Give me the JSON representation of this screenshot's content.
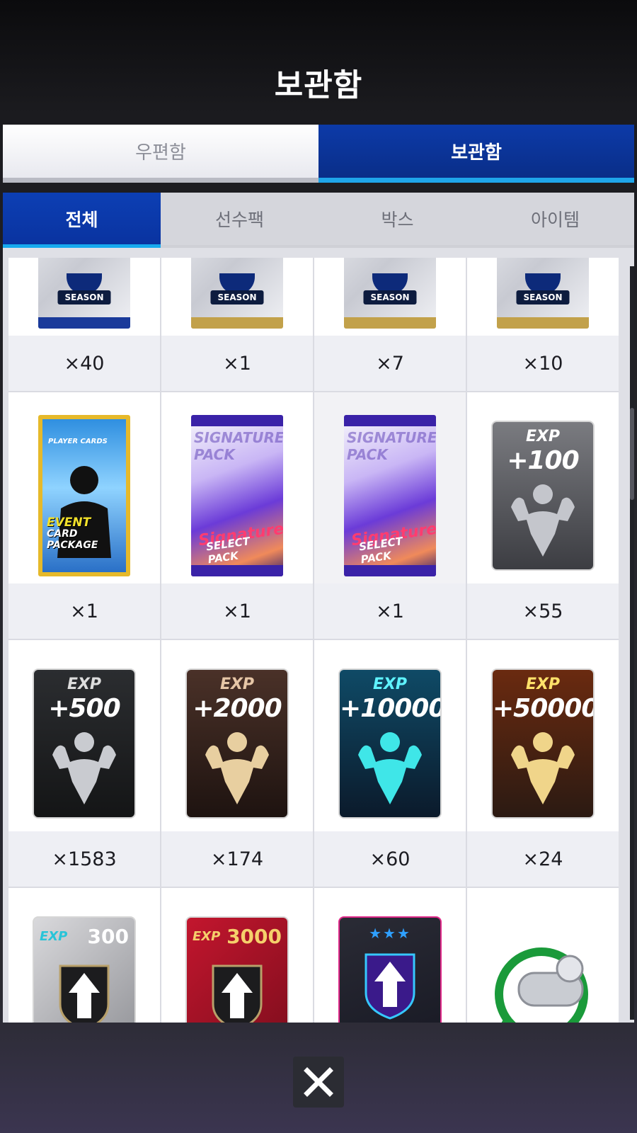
{
  "title": "보관함",
  "main_tabs": [
    {
      "label": "우편함",
      "active": false
    },
    {
      "label": "보관함",
      "active": true
    }
  ],
  "sub_tabs": [
    {
      "label": "전체",
      "active": true
    },
    {
      "label": "선수팩",
      "active": false
    },
    {
      "label": "박스",
      "active": false
    },
    {
      "label": "아이템",
      "active": false
    }
  ],
  "items": [
    {
      "type": "season-pack",
      "pack_label": "SEASON",
      "color": "#1a3a9a",
      "qty": "×40"
    },
    {
      "type": "season-pack",
      "pack_label": "SEASON",
      "color": "#c2a14a",
      "qty": "×1"
    },
    {
      "type": "season-pack",
      "pack_label": "SEASON",
      "color": "#c2a14a",
      "qty": "×7"
    },
    {
      "type": "season-pack",
      "pack_label": "SEASON",
      "color": "#c2a14a",
      "qty": "×10"
    },
    {
      "type": "event-pack",
      "brand": "PLAYER CARDS",
      "line1": "EVENT",
      "line2": "CARD PACKAGE",
      "qty": "×1"
    },
    {
      "type": "signature-pack",
      "bg_text": "SIGNATURE PACK",
      "line1": "Signature",
      "line2": "SELECT PACK",
      "qty": "×1"
    },
    {
      "type": "signature-pack",
      "bg_text": "SIGNATURE PACK",
      "line1": "Signature",
      "line2": "SELECT PACK",
      "qty": "×1"
    },
    {
      "type": "exp",
      "exp_label": "EXP",
      "exp_value": "+100",
      "theme": "gray",
      "qty": "×55"
    },
    {
      "type": "exp",
      "exp_label": "EXP",
      "exp_value": "+500",
      "theme": "dark",
      "qty": "×1583"
    },
    {
      "type": "exp",
      "exp_label": "EXP",
      "exp_value": "+2000",
      "theme": "bronze",
      "qty": "×174"
    },
    {
      "type": "exp",
      "exp_label": "EXP",
      "exp_value": "+10000",
      "theme": "cyan",
      "qty": "×60"
    },
    {
      "type": "exp",
      "exp_label": "EXP",
      "exp_value": "+50000",
      "theme": "gold",
      "qty": "×24"
    },
    {
      "type": "upgrade-exp",
      "exp_label": "EXP",
      "exp_value": "300",
      "theme": "silver",
      "qty": ""
    },
    {
      "type": "upgrade-exp",
      "exp_label": "EXP",
      "exp_value": "3000",
      "theme": "red",
      "qty": ""
    },
    {
      "type": "upgrade-star",
      "stars": "★★★",
      "word": "UPGRADE",
      "qty": ""
    },
    {
      "type": "whistle",
      "qty": ""
    }
  ],
  "icons": {
    "close": "close-icon",
    "whistle": "whistle-icon",
    "upgrade_arrow": "upgrade-arrow-icon"
  }
}
